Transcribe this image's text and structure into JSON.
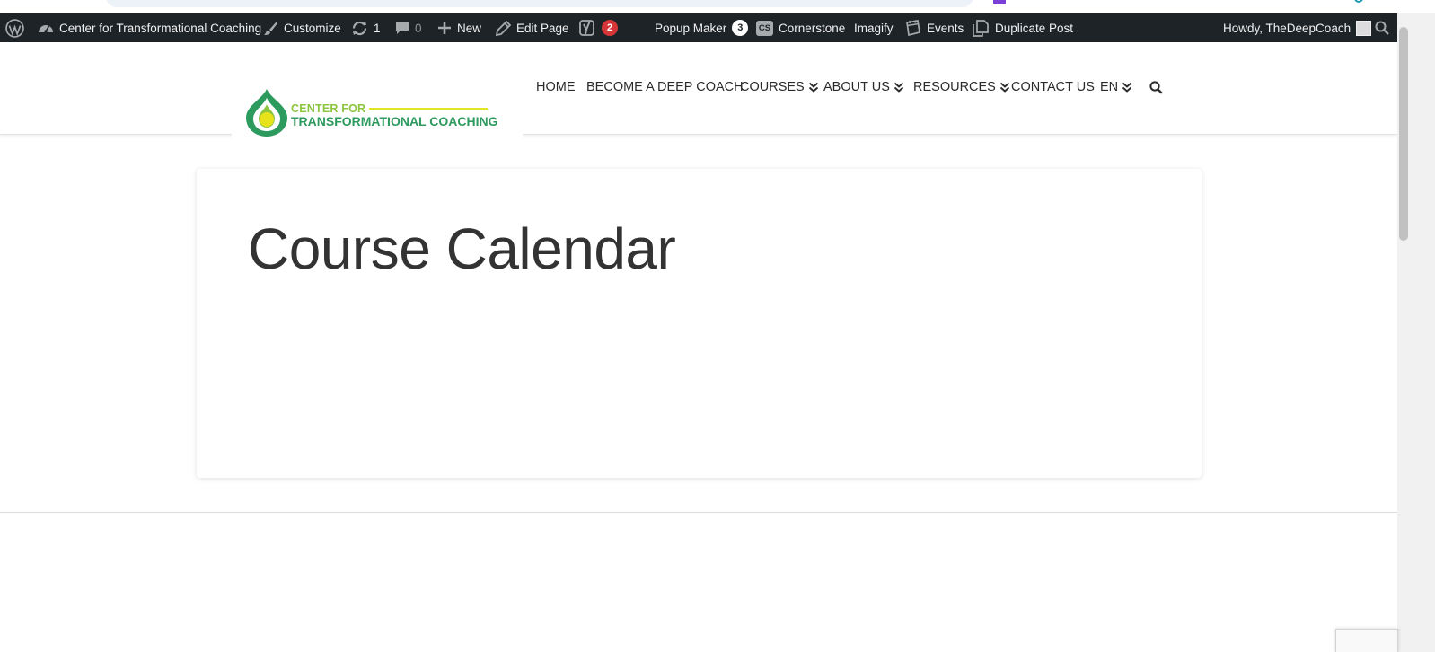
{
  "admin_bar": {
    "site_name": "Center for Transformational Coaching",
    "customize": "Customize",
    "updates_count": "1",
    "comments_count": "0",
    "new_label": "New",
    "edit_page": "Edit Page",
    "yoast_badge": "2",
    "popup_maker": "Popup Maker",
    "popup_maker_badge": "3",
    "cornerstone_icon_text": "CS",
    "cornerstone": "Cornerstone",
    "imagify": "Imagify",
    "events": "Events",
    "duplicate_post": "Duplicate Post",
    "howdy": "Howdy, TheDeepCoach"
  },
  "logo": {
    "line1": "CENTER FOR",
    "line2": "TRANSFORMATIONAL COACHING"
  },
  "nav": {
    "items": [
      {
        "label": "HOME"
      },
      {
        "label": "BECOME A DEEP COACH"
      },
      {
        "label": "COURSES"
      },
      {
        "label": "ABOUT US"
      },
      {
        "label": "RESOURCES"
      },
      {
        "label": "CONTACT US"
      },
      {
        "label": "EN"
      }
    ]
  },
  "main": {
    "title": "Course Calendar"
  },
  "colors": {
    "admin_bar_bg": "#1d2327",
    "logo_green": "#2d9a5e",
    "logo_lime": "#8cc63f",
    "badge_red": "#d63638"
  },
  "icons": {
    "wordpress": "wordpress-icon",
    "dashboard": "dashboard-icon",
    "customize": "brush-icon",
    "updates": "refresh-icon",
    "comments": "comment-icon",
    "new": "plus-icon",
    "edit": "pencil-icon",
    "yoast": "yoast-icon",
    "events": "calendar-icon",
    "duplicate": "duplicate-icon",
    "search": "search-icon"
  }
}
